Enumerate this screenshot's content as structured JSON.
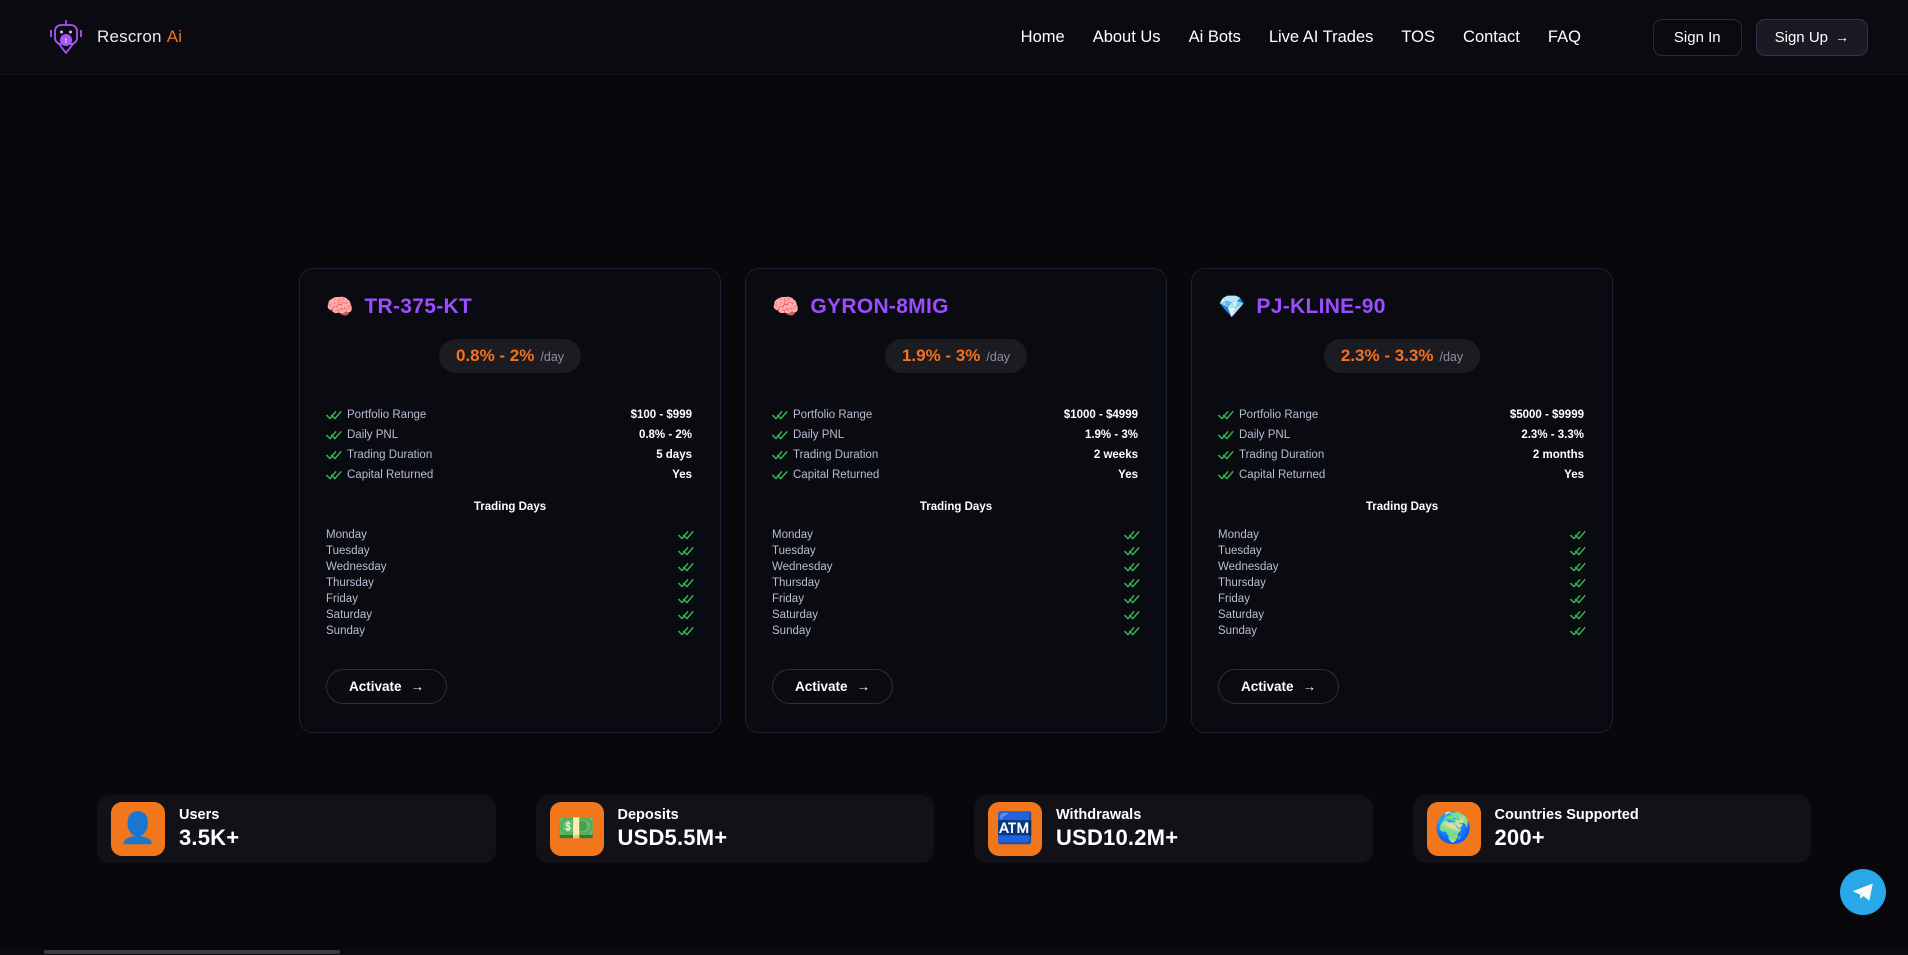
{
  "brand": {
    "name": "Rescron",
    "suffix": "Ai",
    "logo_icon": "robot-logo-icon"
  },
  "nav": {
    "links": [
      {
        "label": "Home"
      },
      {
        "label": "About Us"
      },
      {
        "label": "Ai Bots"
      },
      {
        "label": "Live AI Trades"
      },
      {
        "label": "TOS"
      },
      {
        "label": "Contact"
      },
      {
        "label": "FAQ"
      }
    ],
    "sign_in_label": "Sign In",
    "sign_up_label": "Sign Up",
    "sign_up_arrow": "→"
  },
  "cards": [
    {
      "emoji": "🧠",
      "icon_name": "ai-chip-bot-icon",
      "title": "TR-375-KT",
      "rate_value": "0.8% - 2%",
      "rate_unit": "/day",
      "stats": [
        {
          "label": "Portfolio Range",
          "value": "$100 - $999"
        },
        {
          "label": "Daily PNL",
          "value": "0.8% - 2%"
        },
        {
          "label": "Trading Duration",
          "value": "5 days"
        },
        {
          "label": "Capital Returned",
          "value": "Yes"
        }
      ],
      "days_title": "Trading Days",
      "days": [
        {
          "label": "Monday",
          "active": true
        },
        {
          "label": "Tuesday",
          "active": true
        },
        {
          "label": "Wednesday",
          "active": true
        },
        {
          "label": "Thursday",
          "active": true
        },
        {
          "label": "Friday",
          "active": true
        },
        {
          "label": "Saturday",
          "active": true
        },
        {
          "label": "Sunday",
          "active": true
        }
      ],
      "activate_label": "Activate",
      "activate_arrow": "→"
    },
    {
      "emoji": "🧠",
      "icon_name": "brain-head-icon",
      "title": "GYRON-8MIG",
      "rate_value": "1.9% - 3%",
      "rate_unit": "/day",
      "stats": [
        {
          "label": "Portfolio Range",
          "value": "$1000 - $4999"
        },
        {
          "label": "Daily PNL",
          "value": "1.9% - 3%"
        },
        {
          "label": "Trading Duration",
          "value": "2 weeks"
        },
        {
          "label": "Capital Returned",
          "value": "Yes"
        }
      ],
      "days_title": "Trading Days",
      "days": [
        {
          "label": "Monday",
          "active": true
        },
        {
          "label": "Tuesday",
          "active": true
        },
        {
          "label": "Wednesday",
          "active": true
        },
        {
          "label": "Thursday",
          "active": true
        },
        {
          "label": "Friday",
          "active": true
        },
        {
          "label": "Saturday",
          "active": true
        },
        {
          "label": "Sunday",
          "active": true
        }
      ],
      "activate_label": "Activate",
      "activate_arrow": "→"
    },
    {
      "emoji": "💎",
      "icon_name": "gold-gem-icon",
      "title": "PJ-KLINE-90",
      "rate_value": "2.3% - 3.3%",
      "rate_unit": "/day",
      "stats": [
        {
          "label": "Portfolio Range",
          "value": "$5000 - $9999"
        },
        {
          "label": "Daily PNL",
          "value": "2.3% - 3.3%"
        },
        {
          "label": "Trading Duration",
          "value": "2 months"
        },
        {
          "label": "Capital Returned",
          "value": "Yes"
        }
      ],
      "days_title": "Trading Days",
      "days": [
        {
          "label": "Monday",
          "active": true
        },
        {
          "label": "Tuesday",
          "active": true
        },
        {
          "label": "Wednesday",
          "active": true
        },
        {
          "label": "Thursday",
          "active": true
        },
        {
          "label": "Friday",
          "active": true
        },
        {
          "label": "Saturday",
          "active": true
        },
        {
          "label": "Sunday",
          "active": true
        }
      ],
      "activate_label": "Activate",
      "activate_arrow": "→"
    }
  ],
  "tiles": [
    {
      "label": "Users",
      "value": "3.5K+",
      "emoji": "👤",
      "icon_name": "users-icon"
    },
    {
      "label": "Deposits",
      "value": "USD5.5M+",
      "emoji": "💵",
      "icon_name": "deposits-money-icon"
    },
    {
      "label": "Withdrawals",
      "value": "USD10.2M+",
      "emoji": "🏧",
      "icon_name": "withdrawals-atm-icon"
    },
    {
      "label": "Countries Supported",
      "value": "200+",
      "emoji": "🌍",
      "icon_name": "globe-icon"
    }
  ],
  "floating": {
    "telegram_icon": "telegram-icon"
  },
  "colors": {
    "accent_purple": "#9b4dff",
    "accent_orange": "#f4711d",
    "tile_orange": "#f2761b",
    "check_green": "#2fbf4e",
    "telegram_blue": "#28a8e9",
    "page_bg": "#07070c"
  }
}
